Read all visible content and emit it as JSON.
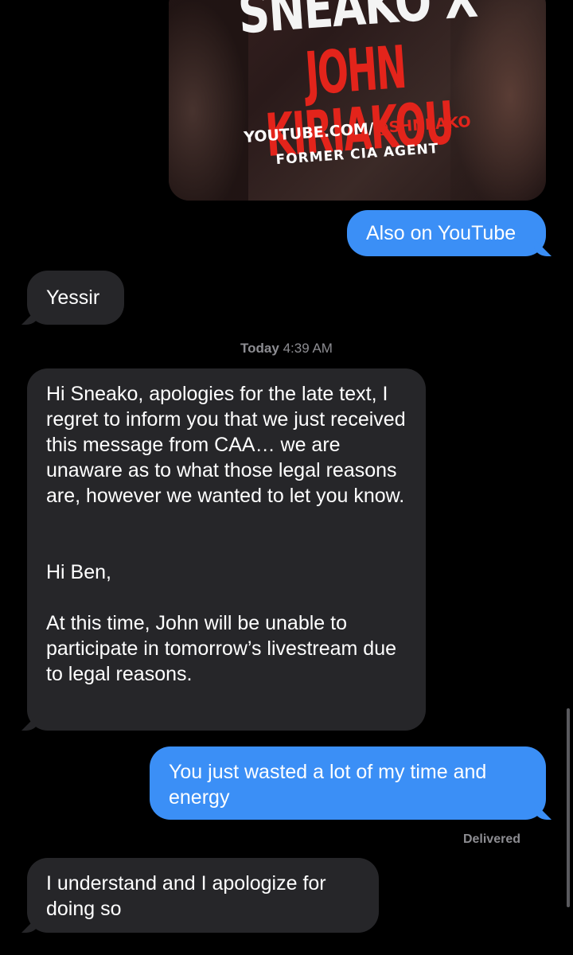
{
  "attachment": {
    "line1": "SNEAKO X",
    "line2": "JOHN KIRIAKOU",
    "url_prefix": "YOUTUBE.COM/",
    "url_handle": "@SHNEAKO",
    "subtitle": "FORMER CIA AGENT"
  },
  "messages": {
    "m1": "Also on YouTube",
    "m2": "Yessir",
    "timestamp_day": "Today",
    "timestamp_time": "4:39 AM",
    "m3": "Hi Sneako, apologies for the late text, I regret to inform you that we just received this message from CAA… we are unaware as to what those legal reasons are, however we wanted to let you know.\n\n\nHi Ben,\n\nAt this time, John will be unable to participate in tomorrow’s livestream due to legal reasons.",
    "m4": "You just wasted a lot of my time and energy",
    "status": "Delivered",
    "m5": "I understand and I apologize for doing so"
  },
  "colors": {
    "sent_bubble": "#3b8ff6",
    "received_bubble": "#262629",
    "background": "#000000",
    "secondary_text": "#8d8d92",
    "poster_red": "#e3241b"
  }
}
